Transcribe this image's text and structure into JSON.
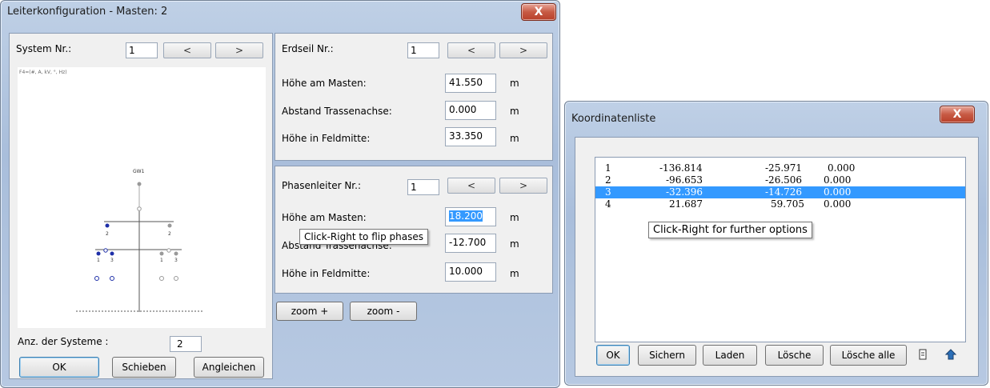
{
  "left_window": {
    "title": "Leiterkonfiguration - Masten: 2",
    "close_label": "X",
    "system": {
      "label": "System Nr.:",
      "value": "1",
      "prev": "<",
      "next": ">"
    },
    "diagram": {
      "caption": "F4=(#, A, kV, °, Hz)",
      "gw_label": "GW1",
      "left_upper_label": "2",
      "right_upper_label": "2",
      "left_lower_labels": [
        "1",
        "3"
      ],
      "right_lower_labels": [
        "1",
        "3"
      ]
    },
    "erdseil": {
      "label": "Erdseil Nr.:",
      "value": "1",
      "prev": "<",
      "next": ">",
      "hoehe_label": "Höhe am Masten:",
      "hoehe_value": "41.550",
      "abstand_label": "Abstand Trassenachse:",
      "abstand_value": "0.000",
      "feld_label": "Höhe in Feldmitte:",
      "feld_value": "33.350",
      "unit": "m"
    },
    "phasenleiter": {
      "label": "Phasenleiter Nr.:",
      "value": "1",
      "prev": "<",
      "next": ">",
      "hoehe_label": "Höhe am Masten:",
      "hoehe_value": "18.200",
      "abstand_label": "Abstand Trassenachse:",
      "abstand_value": "-12.700",
      "feld_label": "Höhe in Feldmitte:",
      "feld_value": "10.000",
      "unit": "m",
      "tooltip": "Click-Right to flip phases"
    },
    "zoom_plus": "zoom +",
    "zoom_minus": "zoom -",
    "anz_label": "Anz. der Systeme :",
    "anz_value": "2",
    "ok": "OK",
    "schieben": "Schieben",
    "angleichen": "Angleichen"
  },
  "right_window": {
    "title": "Koordinatenliste",
    "close_label": "X",
    "rows": [
      {
        "n": "1",
        "x": "-136.814",
        "y": "-25.971",
        "z": "0.000"
      },
      {
        "n": "2",
        "x": "-96.653",
        "y": "-26.506",
        "z": "0.000"
      },
      {
        "n": "3",
        "x": "-32.396",
        "y": "-14.726",
        "z": "0.000"
      },
      {
        "n": "4",
        "x": "21.687",
        "y": "59.705",
        "z": "0.000"
      }
    ],
    "selected_row": 3,
    "tooltip": "Click-Right for further options",
    "ok": "OK",
    "sichern": "Sichern",
    "laden": "Laden",
    "loesche": "Lösche",
    "loesche_alle": "Lösche alle"
  }
}
